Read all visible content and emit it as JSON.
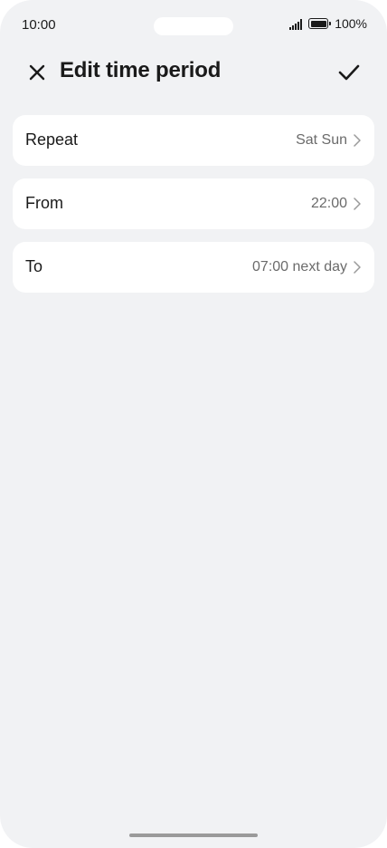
{
  "status_bar": {
    "time": "10:00",
    "battery": "100%",
    "icons": [
      "signal-icon",
      "battery-icon"
    ]
  },
  "header": {
    "title": "Edit time period",
    "close_icon": "close-icon",
    "confirm_icon": "checkmark-icon"
  },
  "settings": [
    {
      "label": "Repeat",
      "value": "Sat Sun"
    },
    {
      "label": "From",
      "value": "22:00"
    },
    {
      "label": "To",
      "value": "07:00 next day"
    }
  ],
  "colors": {
    "background": "#f1f2f4",
    "card": "#ffffff",
    "text_primary": "#1a1a1a",
    "text_secondary": "#6b6b6b"
  }
}
